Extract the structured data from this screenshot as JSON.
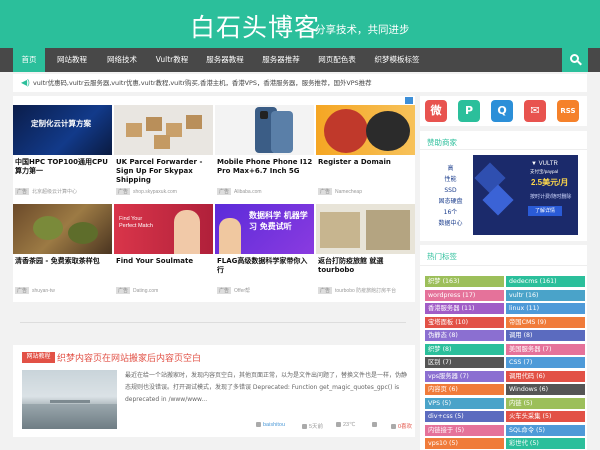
{
  "header": {
    "title": "白石头博客",
    "slogan": "分享技术，共同进步"
  },
  "nav": {
    "items": [
      "首页",
      "网站教程",
      "网络技术",
      "Vultr教程",
      "服务器教程",
      "服务器推荐",
      "网页配色表",
      "织梦模板标签"
    ]
  },
  "notice": {
    "text": "vultr优惠码,vultr云服务器,vultr优惠,vultr教程,vultr购买,香港主机，香港VPS，香港服务器，服务推荐，国外VPS推荐"
  },
  "ads": {
    "badge_tag": "广告",
    "items": [
      {
        "title": "中国HPC TOP100通用CPU算力第一",
        "source": "北京超级云计算中心",
        "image_text": "定制化云计算方案"
      },
      {
        "title": "UK Parcel Forwarder - Sign Up For Skypax Shipping",
        "source": "shop.skypaxuk.com",
        "image_text": ""
      },
      {
        "title": "Mobile Phone Phone I12 Pro Max+6.7 Inch 5G",
        "source": "Alibaba.com",
        "image_text": ""
      },
      {
        "title": "Register a Domain",
        "source": "Namecheap",
        "image_text": ""
      },
      {
        "title": "清香茶园 - 免费索取茶样包",
        "source": "shuyan-tw",
        "image_text": ""
      },
      {
        "title": "Find Your Soulmate",
        "source": "Dating.com",
        "image_text": "Find Your Perfect Match"
      },
      {
        "title": "FLAG高级数据科学家带你入行",
        "source": "Offer帮",
        "image_text": "数据科学 机器学习 免费试听"
      },
      {
        "title": "返台打防疫旅館 就選tourbobo",
        "source": "tourbobo 防疫旅館訂房平台",
        "image_text": ""
      }
    ]
  },
  "post": {
    "category": "网站教程",
    "title": "织梦内容页在网站搬家后内容页空白",
    "excerpt": "最近在给一个站搬家时，发现内容页空白，其他页面正常，以为是文件出问题了，替换文件也是一样，伪静态规则也没错误。打开调试模式，发现了多错误 Deprecated: Function get_magic_quotes_gpc() is deprecated in /www/www...",
    "author": "baishitou",
    "date": "5天前",
    "views": "23℃",
    "comments": "0喜欢"
  },
  "social": {
    "icons": [
      "weibo-icon",
      "p-icon",
      "qq-icon",
      "mail-icon",
      "rss-icon"
    ],
    "glyphs": [
      "微",
      "P",
      "Q",
      "✉",
      "RSS"
    ],
    "colors": [
      "#e8534f",
      "#2bbf9b",
      "#2b8fd8",
      "#e8534f",
      "#f5812a"
    ]
  },
  "sponsor": {
    "title": "赞助商家",
    "left_lines": [
      "高",
      "性能",
      "SSD",
      "固态硬盘",
      "16个",
      "数据中心"
    ],
    "logo": "▼ VULTR",
    "pay": "支付宝/paypal",
    "price": "2.5美元/月",
    "sub": "按时计费/随时删除",
    "button": "了解详情"
  },
  "tags": {
    "title": "热门标签",
    "items": [
      {
        "label": "织梦 (163)",
        "color": "#9cbf5a"
      },
      {
        "label": "dedecms (161)",
        "color": "#2bbf9b"
      },
      {
        "label": "wordpress (17)",
        "color": "#e5729a"
      },
      {
        "label": "vultr (16)",
        "color": "#4aa3c9"
      },
      {
        "label": "香港服务器 (11)",
        "color": "#a05cc7"
      },
      {
        "label": "linux (11)",
        "color": "#4e9ad8"
      },
      {
        "label": "宝塔面板 (10)",
        "color": "#e25146"
      },
      {
        "label": "帝国CMS (9)",
        "color": "#f07b3a"
      },
      {
        "label": "伪静态 (8)",
        "color": "#8b6fd1"
      },
      {
        "label": "调用 (8)",
        "color": "#5b6bbf"
      },
      {
        "label": "织梦 (8)",
        "color": "#2bbf9b"
      },
      {
        "label": "美国服务器 (7)",
        "color": "#e5729a"
      },
      {
        "label": "区别 (7)",
        "color": "#555555"
      },
      {
        "label": "CSS (7)",
        "color": "#4e9ad8"
      },
      {
        "label": "vps服务器 (7)",
        "color": "#8b6fd1"
      },
      {
        "label": "调用代码 (6)",
        "color": "#e25146"
      },
      {
        "label": "内容页 (6)",
        "color": "#f07b3a"
      },
      {
        "label": "Windows (6)",
        "color": "#555555"
      },
      {
        "label": "VPS (5)",
        "color": "#4aa3c9"
      },
      {
        "label": "内链 (5)",
        "color": "#9cbf5a"
      },
      {
        "label": "div+css (5)",
        "color": "#5b6bbf"
      },
      {
        "label": "火车头采集 (5)",
        "color": "#e25146"
      },
      {
        "label": "内链接于 (5)",
        "color": "#e5729a"
      },
      {
        "label": "SQL命令 (5)",
        "color": "#4e9ad8"
      },
      {
        "label": "vps10 (5)",
        "color": "#f07b3a"
      },
      {
        "label": "彩世代 (5)",
        "color": "#2bbf9b"
      }
    ]
  }
}
